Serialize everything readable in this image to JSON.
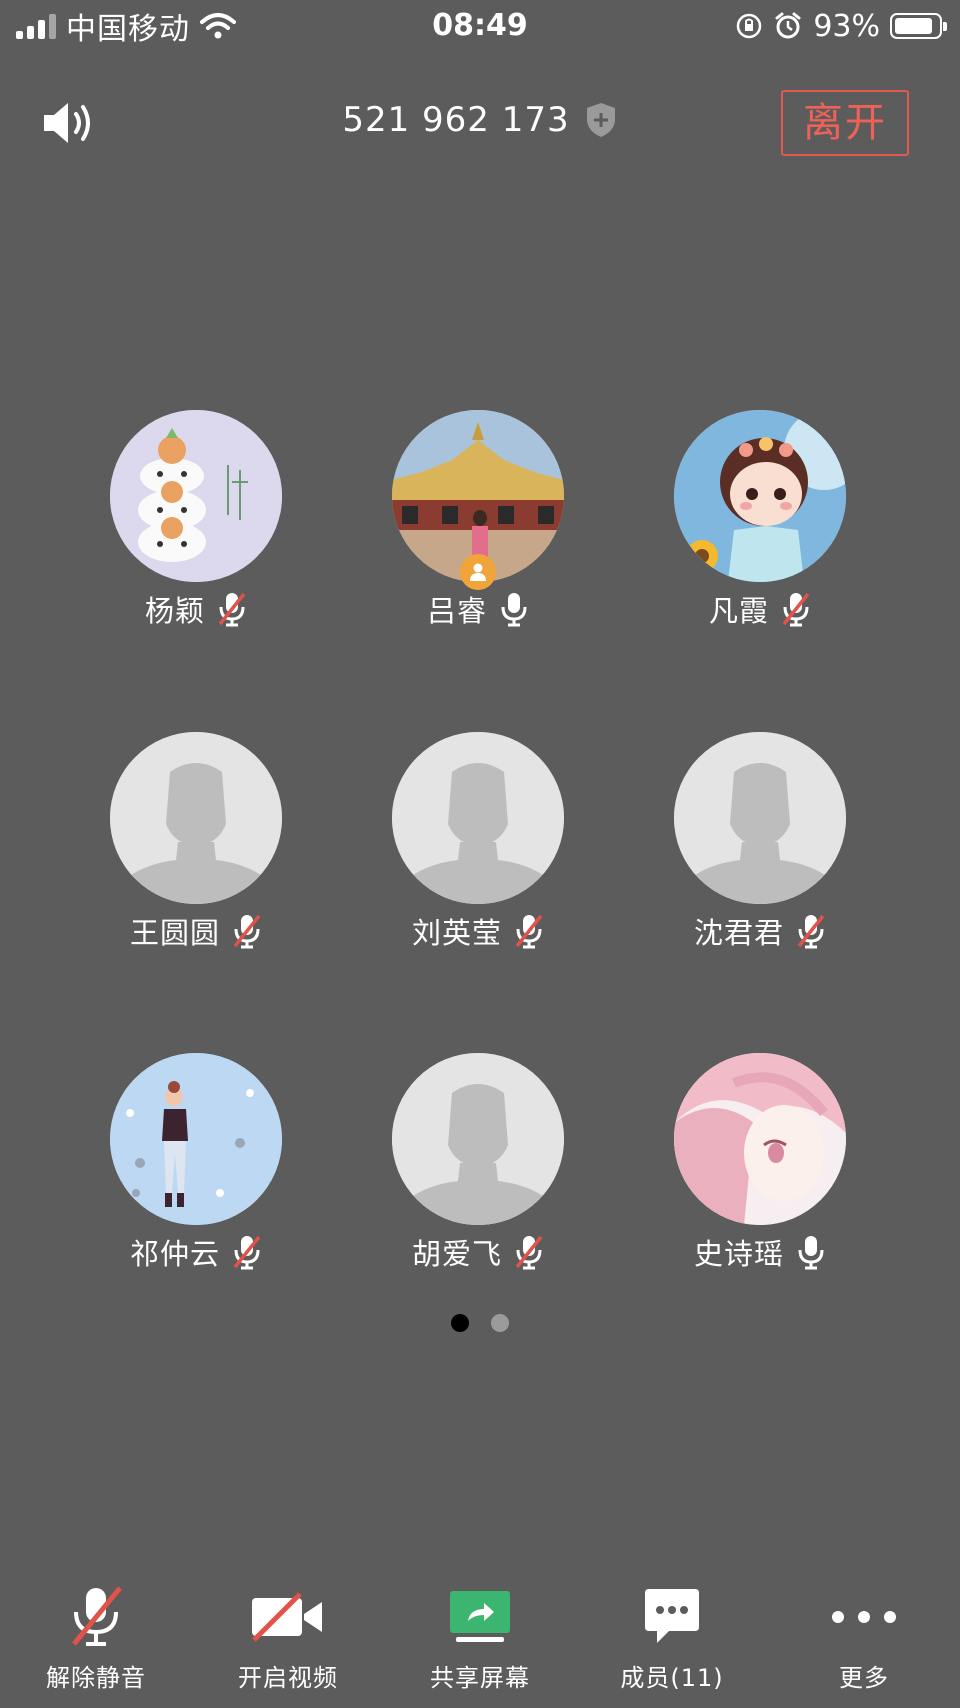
{
  "status_bar": {
    "carrier": "中国移动",
    "time": "08:49",
    "battery": "93%",
    "battery_level": 0.93
  },
  "header": {
    "meeting_id": "521 962 173",
    "leave_label": "离开"
  },
  "participants": [
    {
      "name": "杨颖",
      "muted": true,
      "avatar": "cat-avatar"
    },
    {
      "name": "吕睿",
      "muted": false,
      "avatar": "temple-photo-avatar",
      "host": true
    },
    {
      "name": "凡霞",
      "muted": true,
      "avatar": "cartoon-girl-avatar"
    },
    {
      "name": "王圆圆",
      "muted": true,
      "avatar": "default-avatar"
    },
    {
      "name": "刘英莹",
      "muted": true,
      "avatar": "default-avatar"
    },
    {
      "name": "沈君君",
      "muted": true,
      "avatar": "default-avatar"
    },
    {
      "name": "祁仲云",
      "muted": true,
      "avatar": "fashion-girl-avatar"
    },
    {
      "name": "胡爱飞",
      "muted": true,
      "avatar": "default-avatar"
    },
    {
      "name": "史诗瑶",
      "muted": false,
      "avatar": "anime-girl-avatar"
    }
  ],
  "pagination": {
    "current": 1,
    "total": 2
  },
  "toolbar": {
    "unmute": "解除静音",
    "start_video": "开启视频",
    "share_screen": "共享屏幕",
    "members": "成员(11)",
    "more": "更多"
  },
  "colors": {
    "background": "#5c5c5c",
    "leave_red": "#f06157",
    "share_green": "#3bb56f",
    "host_badge": "#f0a43a",
    "muted_slash": "#e0524a"
  }
}
